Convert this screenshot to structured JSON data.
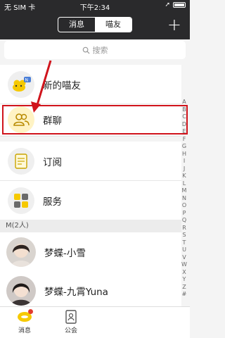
{
  "status_bar": {
    "carrier": "无 SIM 卡",
    "time": "下午2:34"
  },
  "header": {
    "tabs": [
      {
        "label": "消息",
        "active": false
      },
      {
        "label": "喵友",
        "active": true
      }
    ],
    "add_icon": "plus-icon"
  },
  "search": {
    "placeholder": "搜索"
  },
  "entries": [
    {
      "label": "新的喵友",
      "icon": "new-friends-icon"
    },
    {
      "label": "群聊",
      "icon": "group-chat-icon"
    },
    {
      "label": "订阅",
      "icon": "subscribe-icon"
    },
    {
      "label": "服务",
      "icon": "services-icon"
    }
  ],
  "section": {
    "title": "M(2人)"
  },
  "contacts": [
    {
      "name": "梦蝶-小雪"
    },
    {
      "name": "梦蝶-九霄Yuna"
    }
  ],
  "index_letters": [
    "A",
    "B",
    "C",
    "D",
    "E",
    "F",
    "G",
    "H",
    "I",
    "J",
    "K",
    "L",
    "M",
    "N",
    "O",
    "P",
    "Q",
    "R",
    "S",
    "T",
    "U",
    "V",
    "W",
    "X",
    "Y",
    "Z",
    "#"
  ],
  "tabbar": [
    {
      "label": "消息",
      "icon": "message-icon",
      "badge": true
    },
    {
      "label": "公会",
      "icon": "guild-icon",
      "badge": false
    }
  ],
  "colors": {
    "header_bg": "#2a2a2c",
    "accent_yellow": "#f6c900",
    "highlight_red": "#d0141c"
  }
}
